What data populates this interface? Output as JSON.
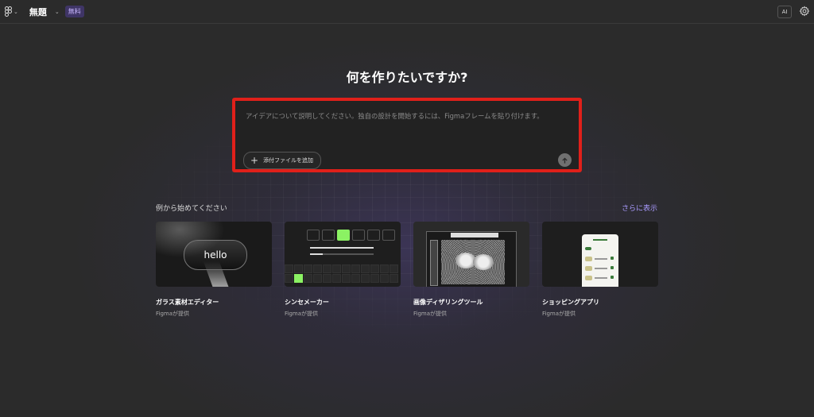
{
  "topbar": {
    "title": "無題",
    "plan_badge": "無料",
    "ai_label": "AI"
  },
  "heading": "何を作りたいですか?",
  "prompt": {
    "placeholder": "アイデアについて説明してください。独自の設計を開始するには、Figmaフレームを貼り付けます。",
    "attach_label": "添付ファイルを追加"
  },
  "examples": {
    "section_title": "例から始めてください",
    "show_more": "さらに表示",
    "cards": [
      {
        "title": "ガラス素材エディター",
        "subtitle": "Figmaが提供",
        "thumb_text": "hello"
      },
      {
        "title": "シンセメーカー",
        "subtitle": "Figmaが提供"
      },
      {
        "title": "画像ディザリングツール",
        "subtitle": "Figmaが提供"
      },
      {
        "title": "ショッピングアプリ",
        "subtitle": "Figmaが提供"
      }
    ]
  },
  "colors": {
    "highlight_border": "#e0201a",
    "accent_link": "#a99bff",
    "synth_accent": "#8bf263"
  }
}
